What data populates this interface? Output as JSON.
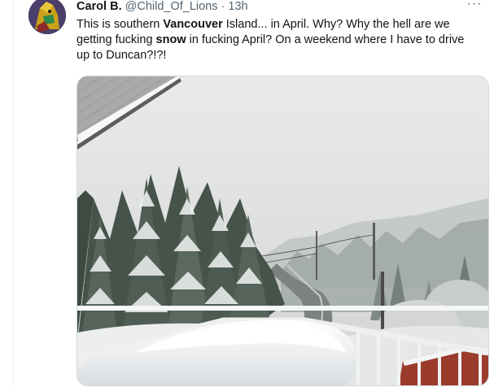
{
  "tweet": {
    "author": {
      "display_name": "Carol B.",
      "handle": "@Child_Of_Lions",
      "separator": "·",
      "time": "13h"
    },
    "more_icon": "more-horizontal-icon",
    "more_label": "···",
    "text": {
      "part1": "This is southern ",
      "bold1": "Vancouver",
      "part2": " Island... in April. Why? Why the hell are we getting fucking ",
      "bold2": "snow",
      "part3": " in fucking April? On a weekend where I have to drive up to Duncan?!?!"
    },
    "media": {
      "type": "photo",
      "subject": "snowy-balcony-view"
    }
  },
  "colors": {
    "text_primary": "#0f1419",
    "text_secondary": "#536471",
    "border": "#cfd9de"
  }
}
